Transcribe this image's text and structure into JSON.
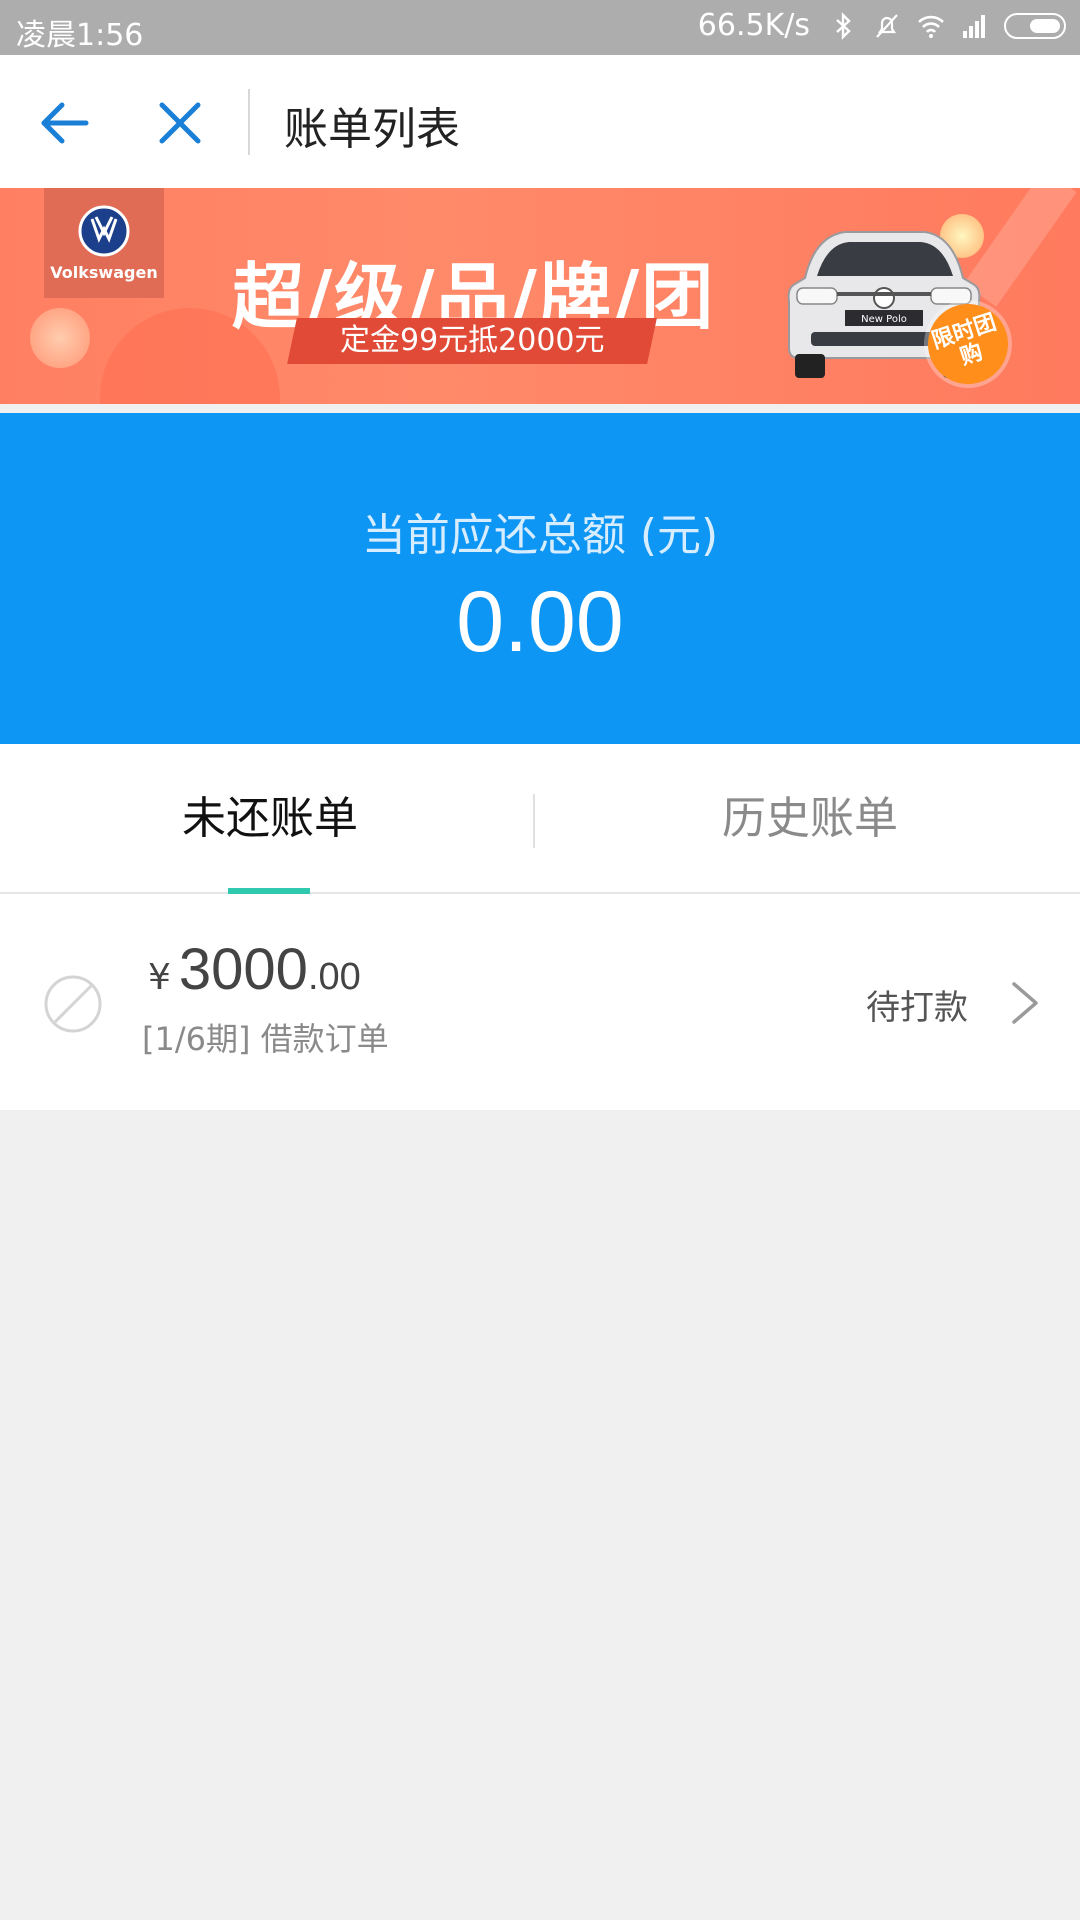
{
  "status_bar": {
    "time": "凌晨1:56",
    "net_speed": "66.5K/s",
    "icons": [
      "bluetooth-icon",
      "mute-bell-icon",
      "wifi-icon",
      "signal-icon",
      "battery-icon"
    ]
  },
  "nav": {
    "title": "账单列表",
    "back_icon": "back-arrow-icon",
    "close_icon": "close-icon",
    "icon_color": "#1a7fd6"
  },
  "banner": {
    "brand": "Volkswagen",
    "headline": "超/级/品/牌/团",
    "subline": "定金99元抵2000元",
    "badge": "限时团购",
    "car_plate": "New Polo"
  },
  "summary": {
    "label": "当前应还总额 (元)",
    "amount": "0.00",
    "background": "#0e96f5"
  },
  "tabs": [
    {
      "label": "未还账单",
      "active": true
    },
    {
      "label": "历史账单",
      "active": false
    }
  ],
  "tab_indicator_color": "#2fc9b0",
  "bills": [
    {
      "currency": "¥",
      "amount_int": "3000",
      "amount_dec": ".00",
      "description": "[1/6期] 借款订单",
      "status": "待打款"
    }
  ]
}
